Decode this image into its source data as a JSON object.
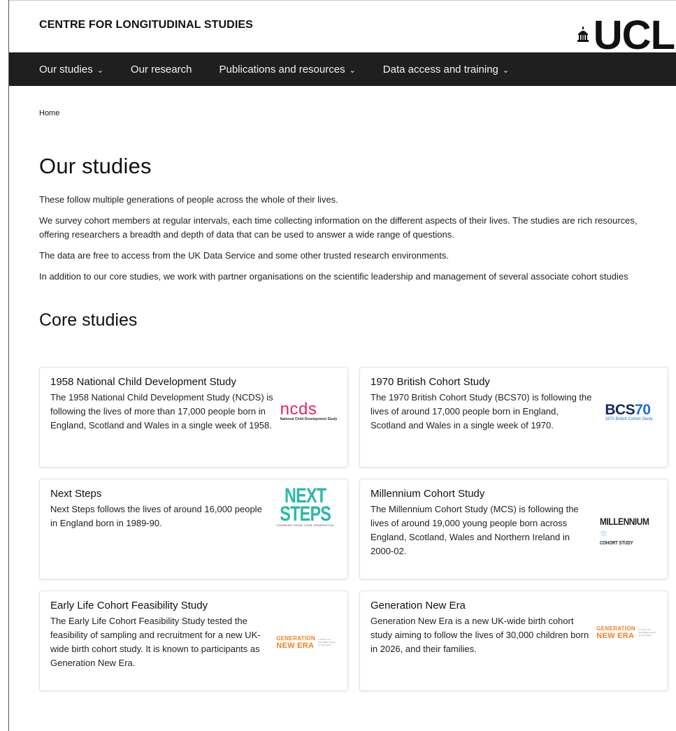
{
  "header": {
    "site_name": "CENTRE FOR LONGITUDINAL STUDIES",
    "logo_text": "UCL"
  },
  "nav": {
    "items": [
      {
        "label": "Our studies",
        "has_dropdown": true
      },
      {
        "label": "Our research",
        "has_dropdown": false
      },
      {
        "label": "Publications and resources",
        "has_dropdown": true
      },
      {
        "label": "Data access and training",
        "has_dropdown": true
      }
    ]
  },
  "breadcrumb": "Home",
  "page": {
    "title": "Our studies",
    "intro": [
      "These follow multiple generations of people across the whole of their lives.",
      "We survey cohort members at regular intervals, each time collecting information on the different aspects of their lives. The studies are rich resources, offering researchers a breadth and depth of data that can be used to answer a wide range of questions.",
      "The data are free to access from the UK Data Service and some other trusted research environments.",
      "In addition to our core studies, we work with partner organisations on the scientific leadership and management of several associate cohort studies"
    ],
    "section_title": "Core studies"
  },
  "cards": [
    {
      "title": "1958 National Child Development Study",
      "description": "The 1958 National Child Development Study (NCDS) is following the lives of more than 17,000 people born in England, Scotland and Wales in a single week of 1958.",
      "logo": {
        "big": "ncds",
        "small": "National Child Development Study"
      }
    },
    {
      "title": "1970 British Cohort Study",
      "description": "The 1970 British Cohort Study (BCS70) is following the lives of around 17,000 people born in England, Scotland and Wales in a single week of 1970.",
      "logo": {
        "big_a": "BCS",
        "big_b": "70",
        "small": "1970 British Cohort Study"
      }
    },
    {
      "title": "Next Steps",
      "description": "Next Steps follows the lives of around 16,000 people in England born in 1989-90.",
      "logo": {
        "line1": "NEXT",
        "line2": "STEPS",
        "small": "LEARNING FROM YOUR GENERATION"
      }
    },
    {
      "title": "Millennium Cohort Study",
      "description": "The Millennium Cohort Study (MCS) is following the lives of around 19,000 young people born across England, Scotland, Wales and Northern Ireland in 2000-02.",
      "logo": {
        "big": "MILLENNIUM",
        "small": "COHORT STUDY"
      }
    },
    {
      "title": "Early Life Cohort Feasibility Study",
      "description": "The Early Life Cohort Feasibility Study tested the feasibility of sampling and recruitment for a new UK-wide birth cohort study. It is known to participants as Generation New Era.",
      "logo": {
        "w1": "GENERATION",
        "w2": "NEW ERA",
        "tag": "A STUDY OF CHILDREN BORN IN THE 2020s"
      }
    },
    {
      "title": "Generation New Era",
      "description": "Generation New Era is a new UK-wide birth cohort study aiming to follow the lives of 30,000 children born in 2026, and their families.",
      "logo": {
        "w1": "GENERATION",
        "w2": "NEW ERA",
        "tag": "A STUDY OF CHILDREN BORN IN THE 2020s"
      }
    }
  ],
  "colors": {
    "nav_bg": "#1f1f1f",
    "ncds": "#e6245e",
    "bcs_dark": "#102a5c",
    "bcs_light": "#1e6fd0",
    "next_steps": "#2bb8a8",
    "gne": "#f08020"
  }
}
